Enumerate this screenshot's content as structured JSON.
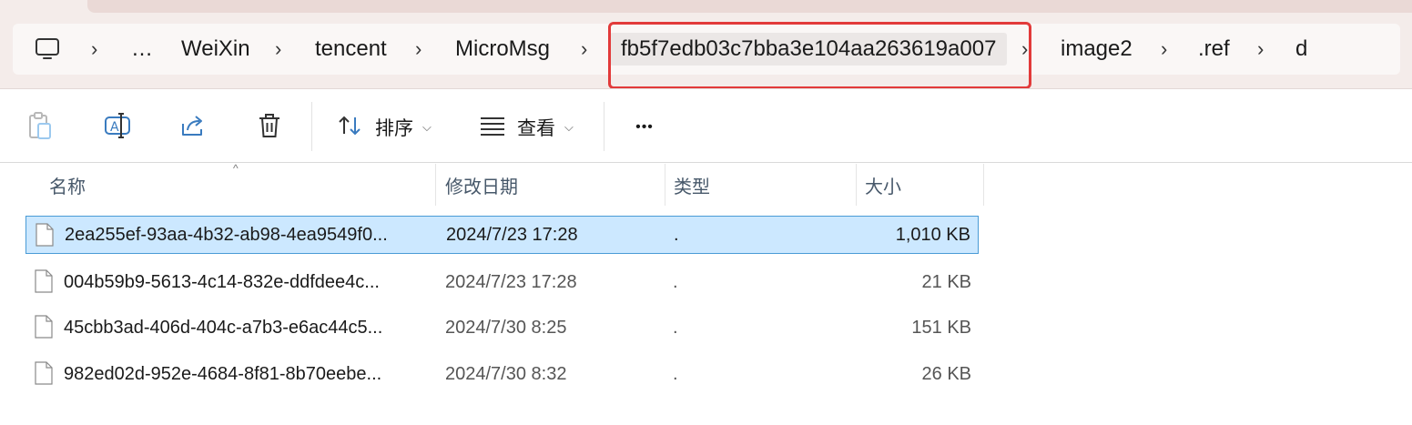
{
  "address_bar": {
    "segments": [
      "…",
      "WeiXin",
      "tencent",
      "MicroMsg",
      "fb5f7edb03c7bba3e104aa263619a007",
      "image2",
      ".ref",
      "d"
    ],
    "chevron": "›",
    "computer_icon": "computer-icon"
  },
  "toolbar": {
    "paste_icon": "paste-icon",
    "rename_icon": "rename-icon",
    "share_icon": "share-icon",
    "delete_icon": "delete-icon",
    "sort_label": "排序",
    "view_label": "查看",
    "more_label": "•••"
  },
  "columns": {
    "name": "名称",
    "date": "修改日期",
    "type": "类型",
    "size": "大小"
  },
  "files": [
    {
      "name": "2ea255ef-93aa-4b32-ab98-4ea9549f0...",
      "date": "2024/7/23 17:28",
      "type": ".",
      "size": "1,010 KB"
    },
    {
      "name": "004b59b9-5613-4c14-832e-ddfdee4c...",
      "date": "2024/7/23 17:28",
      "type": ".",
      "size": "21 KB"
    },
    {
      "name": "45cbb3ad-406d-404c-a7b3-e6ac44c5...",
      "date": "2024/7/30 8:25",
      "type": ".",
      "size": "151 KB"
    },
    {
      "name": "982ed02d-952e-4684-8f81-8b70eebe...",
      "date": "2024/7/30 8:32",
      "type": ".",
      "size": "26 KB"
    }
  ],
  "colors": {
    "highlight_box": "#e23a3a",
    "selection": "#cce8ff",
    "selection_border": "#4a9bd6"
  }
}
